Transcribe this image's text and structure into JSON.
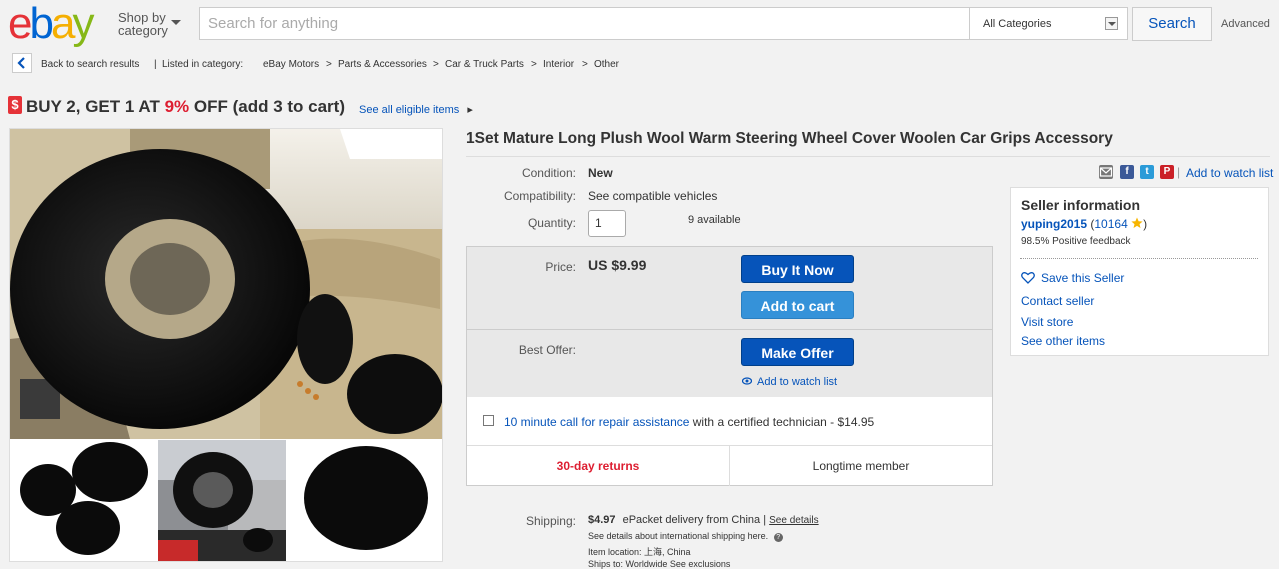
{
  "header": {
    "logo": [
      "e",
      "b",
      "a",
      "y"
    ],
    "shop_by_line1": "Shop by",
    "shop_by_line2": "category",
    "search_placeholder": "Search for anything",
    "category": "All Categories",
    "search_button": "Search",
    "advanced": "Advanced"
  },
  "breadcrumb": {
    "back": "Back to search results",
    "sep": "|",
    "listed_in": "Listed in category:",
    "items": [
      "eBay Motors",
      "Parts & Accessories",
      "Car & Truck Parts",
      "Interior",
      "Other"
    ],
    "arrow": ">"
  },
  "promo": {
    "icon": "$",
    "text_before": "BUY 2, GET 1 AT",
    "percent": "9%",
    "text_after": "OFF (add 3 to cart)",
    "link": "See all eligible items",
    "arrow": "▸"
  },
  "listing": {
    "title": "1Set Mature Long Plush Wool Warm Steering Wheel Cover Woolen Car Grips Accessory",
    "condition_label": "Condition:",
    "condition": "New",
    "compat_label": "Compatibility:",
    "compat_link": "See compatible vehicles",
    "quantity_label": "Quantity:",
    "quantity": "1",
    "available": "9 available",
    "price_label": "Price:",
    "price": "US $9.99",
    "buy_now": "Buy It Now",
    "add_to_cart": "Add to cart",
    "best_offer_label": "Best Offer:",
    "make_offer": "Make Offer",
    "watch_link": "Add to watch list",
    "repair_link": "10 minute call for repair assistance",
    "repair_text": "with a certified technician - $14.95",
    "returns": "30-day returns",
    "member": "Longtime member",
    "shipping_label": "Shipping:",
    "shipping_price": "$4.97",
    "shipping_method": "ePacket delivery from China |",
    "see_details": "See details",
    "intl_note": "See details about international shipping here.",
    "help_icon": "?",
    "item_location": "Item location:  上海, China",
    "ships_to": "Ships to:  Worldwide   See exclusions"
  },
  "seller": {
    "heading": "Seller information",
    "name": "yuping2015",
    "score": "10164",
    "feedback": "98.5% Positive feedback",
    "save": "Save this Seller",
    "contact": "Contact seller",
    "store": "Visit store",
    "other": "See other items"
  },
  "share": {
    "watch": "Add to watch list",
    "sep": "|",
    "icons": [
      "mail-icon",
      "facebook-icon",
      "twitter-icon",
      "pinterest-icon"
    ],
    "fb": "f",
    "tw": "t",
    "pin": "P"
  },
  "colors": {
    "brand_red": "#e53238",
    "brand_blue": "#0064d2",
    "brand_yellow": "#f5af02",
    "brand_green": "#86b817",
    "link": "#0654ba",
    "returns_red": "#dd1e31"
  }
}
